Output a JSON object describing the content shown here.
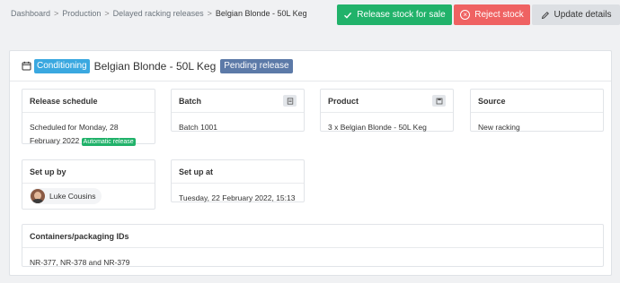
{
  "breadcrumb": {
    "items": [
      "Dashboard",
      "Production",
      "Delayed racking releases"
    ],
    "current": "Belgian Blonde - 50L Keg",
    "separator": ">"
  },
  "actions": {
    "release_label": "Release stock for sale",
    "reject_label": "Reject stock",
    "update_label": "Update details"
  },
  "header": {
    "calendar_icon": "calendar-icon",
    "conditioning_badge": "Conditioning",
    "title": "Belgian Blonde - 50L Keg",
    "status_badge": "Pending release"
  },
  "cards": {
    "release_schedule": {
      "title": "Release schedule",
      "text": "Scheduled for Monday, 28 February 2022",
      "badge": "Automatic release"
    },
    "batch": {
      "title": "Batch",
      "value": "Batch 1001",
      "icon": "document-icon"
    },
    "product": {
      "title": "Product",
      "value": "3 x Belgian Blonde - 50L Keg",
      "icon": "save-icon"
    },
    "source": {
      "title": "Source",
      "value": "New racking"
    },
    "setup_by": {
      "title": "Set up by",
      "user": "Luke Cousins"
    },
    "setup_at": {
      "title": "Set up at",
      "value": "Tuesday, 22 February 2022, 15:13"
    },
    "containers": {
      "title": "Containers/packaging IDs",
      "value": "NR-377, NR-378 and NR-379"
    }
  },
  "colors": {
    "release": "#21b26a",
    "reject": "#ef6262",
    "conditioning": "#3aa8e0",
    "pending": "#5c7aa8"
  }
}
